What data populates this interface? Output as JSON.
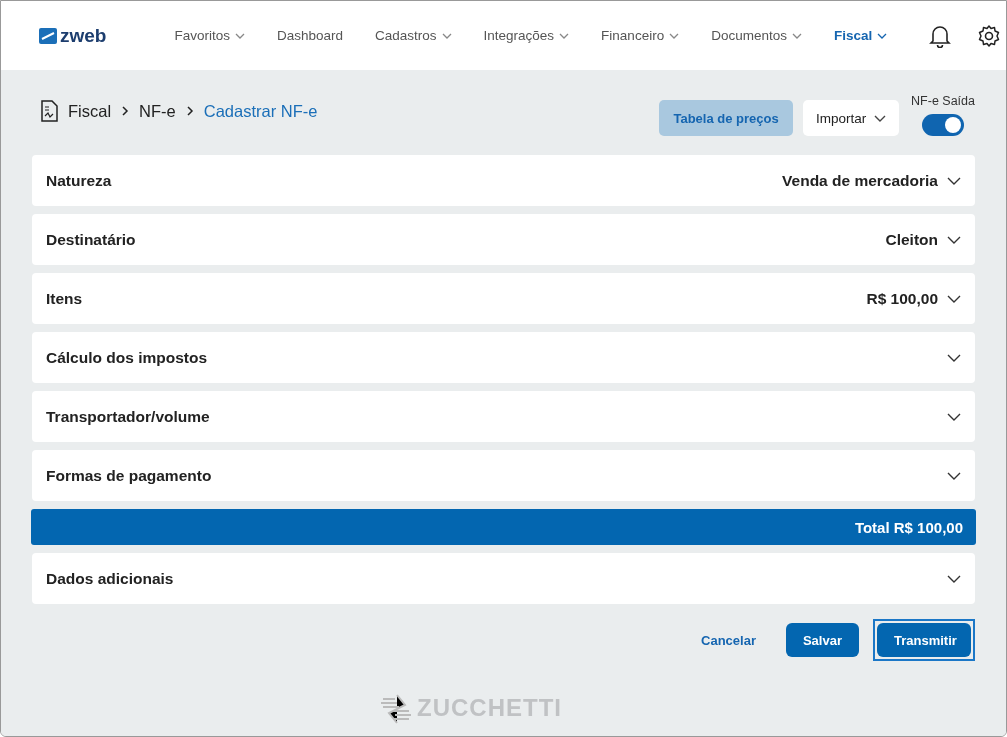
{
  "header": {
    "logo": "zweb",
    "nav": [
      {
        "label": "Favoritos",
        "dropdown": true,
        "selected": false
      },
      {
        "label": "Dashboard",
        "dropdown": false,
        "selected": false
      },
      {
        "label": "Cadastros",
        "dropdown": true,
        "selected": false
      },
      {
        "label": "Integrações",
        "dropdown": true,
        "selected": false
      },
      {
        "label": "Financeiro",
        "dropdown": true,
        "selected": false
      },
      {
        "label": "Documentos",
        "dropdown": true,
        "selected": false
      },
      {
        "label": "Fiscal",
        "dropdown": true,
        "selected": true
      }
    ]
  },
  "breadcrumb": [
    "Fiscal",
    "NF-e",
    "Cadastrar NF-e"
  ],
  "actions": {
    "price_table": "Tabela de preços",
    "import": "Importar",
    "toggle": {
      "label": "NF-e Saída",
      "on": true
    }
  },
  "sections": [
    {
      "label": "Natureza",
      "value": "Venda de mercadoria"
    },
    {
      "label": "Destinatário",
      "value": "Cleiton"
    },
    {
      "label": "Itens",
      "value": "R$ 100,00"
    },
    {
      "label": "Cálculo dos impostos"
    },
    {
      "label": "Transportador/volume"
    },
    {
      "label": "Formas de pagamento"
    }
  ],
  "total": "Total R$ 100,00",
  "extra_sections": [
    {
      "label": "Dados adicionais"
    }
  ],
  "buttons": {
    "cancel": "Cancelar",
    "save": "Salvar",
    "transmit": {
      "label": "Transmitir",
      "focused": true
    }
  },
  "footer_logo": "ZUCCHETTI"
}
